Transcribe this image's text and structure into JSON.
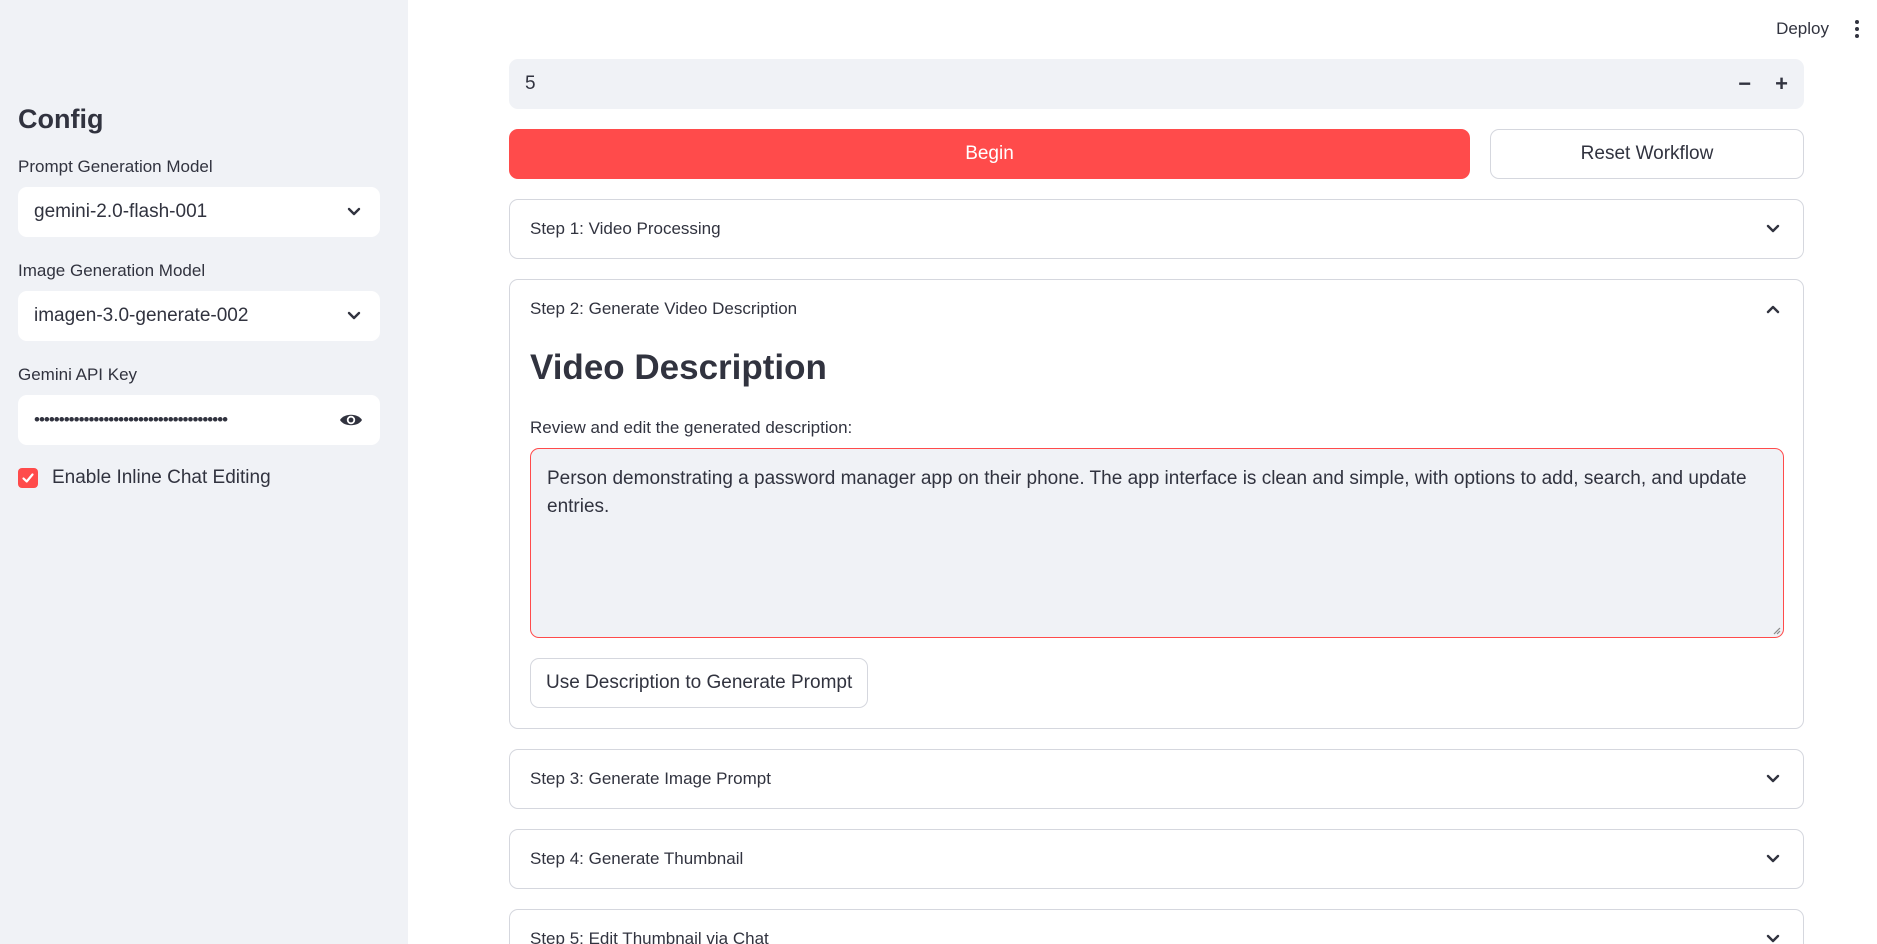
{
  "sidebar": {
    "title": "Config",
    "prompt_model": {
      "label": "Prompt Generation Model",
      "value": "gemini-2.0-flash-001"
    },
    "image_model": {
      "label": "Image Generation Model",
      "value": "imagen-3.0-generate-002"
    },
    "api_key": {
      "label": "Gemini API Key",
      "value": "•••••••••••••••••••••••••••••••••••••••"
    },
    "inline_chat": {
      "label": "Enable Inline Chat Editing",
      "checked": true
    }
  },
  "topbar": {
    "deploy_label": "Deploy"
  },
  "number_input": {
    "value": "5",
    "minus": "−",
    "plus": "+"
  },
  "buttons": {
    "begin": "Begin",
    "reset": "Reset Workflow"
  },
  "steps": [
    {
      "label": "Step 1: Video Processing",
      "expanded": false
    },
    {
      "label": "Step 2: Generate Video Description",
      "expanded": true
    },
    {
      "label": "Step 3: Generate Image Prompt",
      "expanded": false
    },
    {
      "label": "Step 4: Generate Thumbnail",
      "expanded": false
    },
    {
      "label": "Step 5: Edit Thumbnail via Chat",
      "expanded": false
    }
  ],
  "step2": {
    "heading": "Video Description",
    "textarea_label": "Review and edit the generated description:",
    "textarea_value": "Person demonstrating a password manager app on their phone. The app interface is clean and simple, with options to add, search, and update entries.",
    "generate_button": "Use Description to Generate Prompt"
  },
  "colors": {
    "accent": "#ff4b4b",
    "sidebar_bg": "#f0f2f6",
    "text": "#31333f"
  },
  "icons": [
    "chevron-down-icon",
    "chevron-up-icon",
    "eye-icon",
    "checkmark-icon",
    "kebab-menu-icon",
    "resize-handle-icon"
  ]
}
